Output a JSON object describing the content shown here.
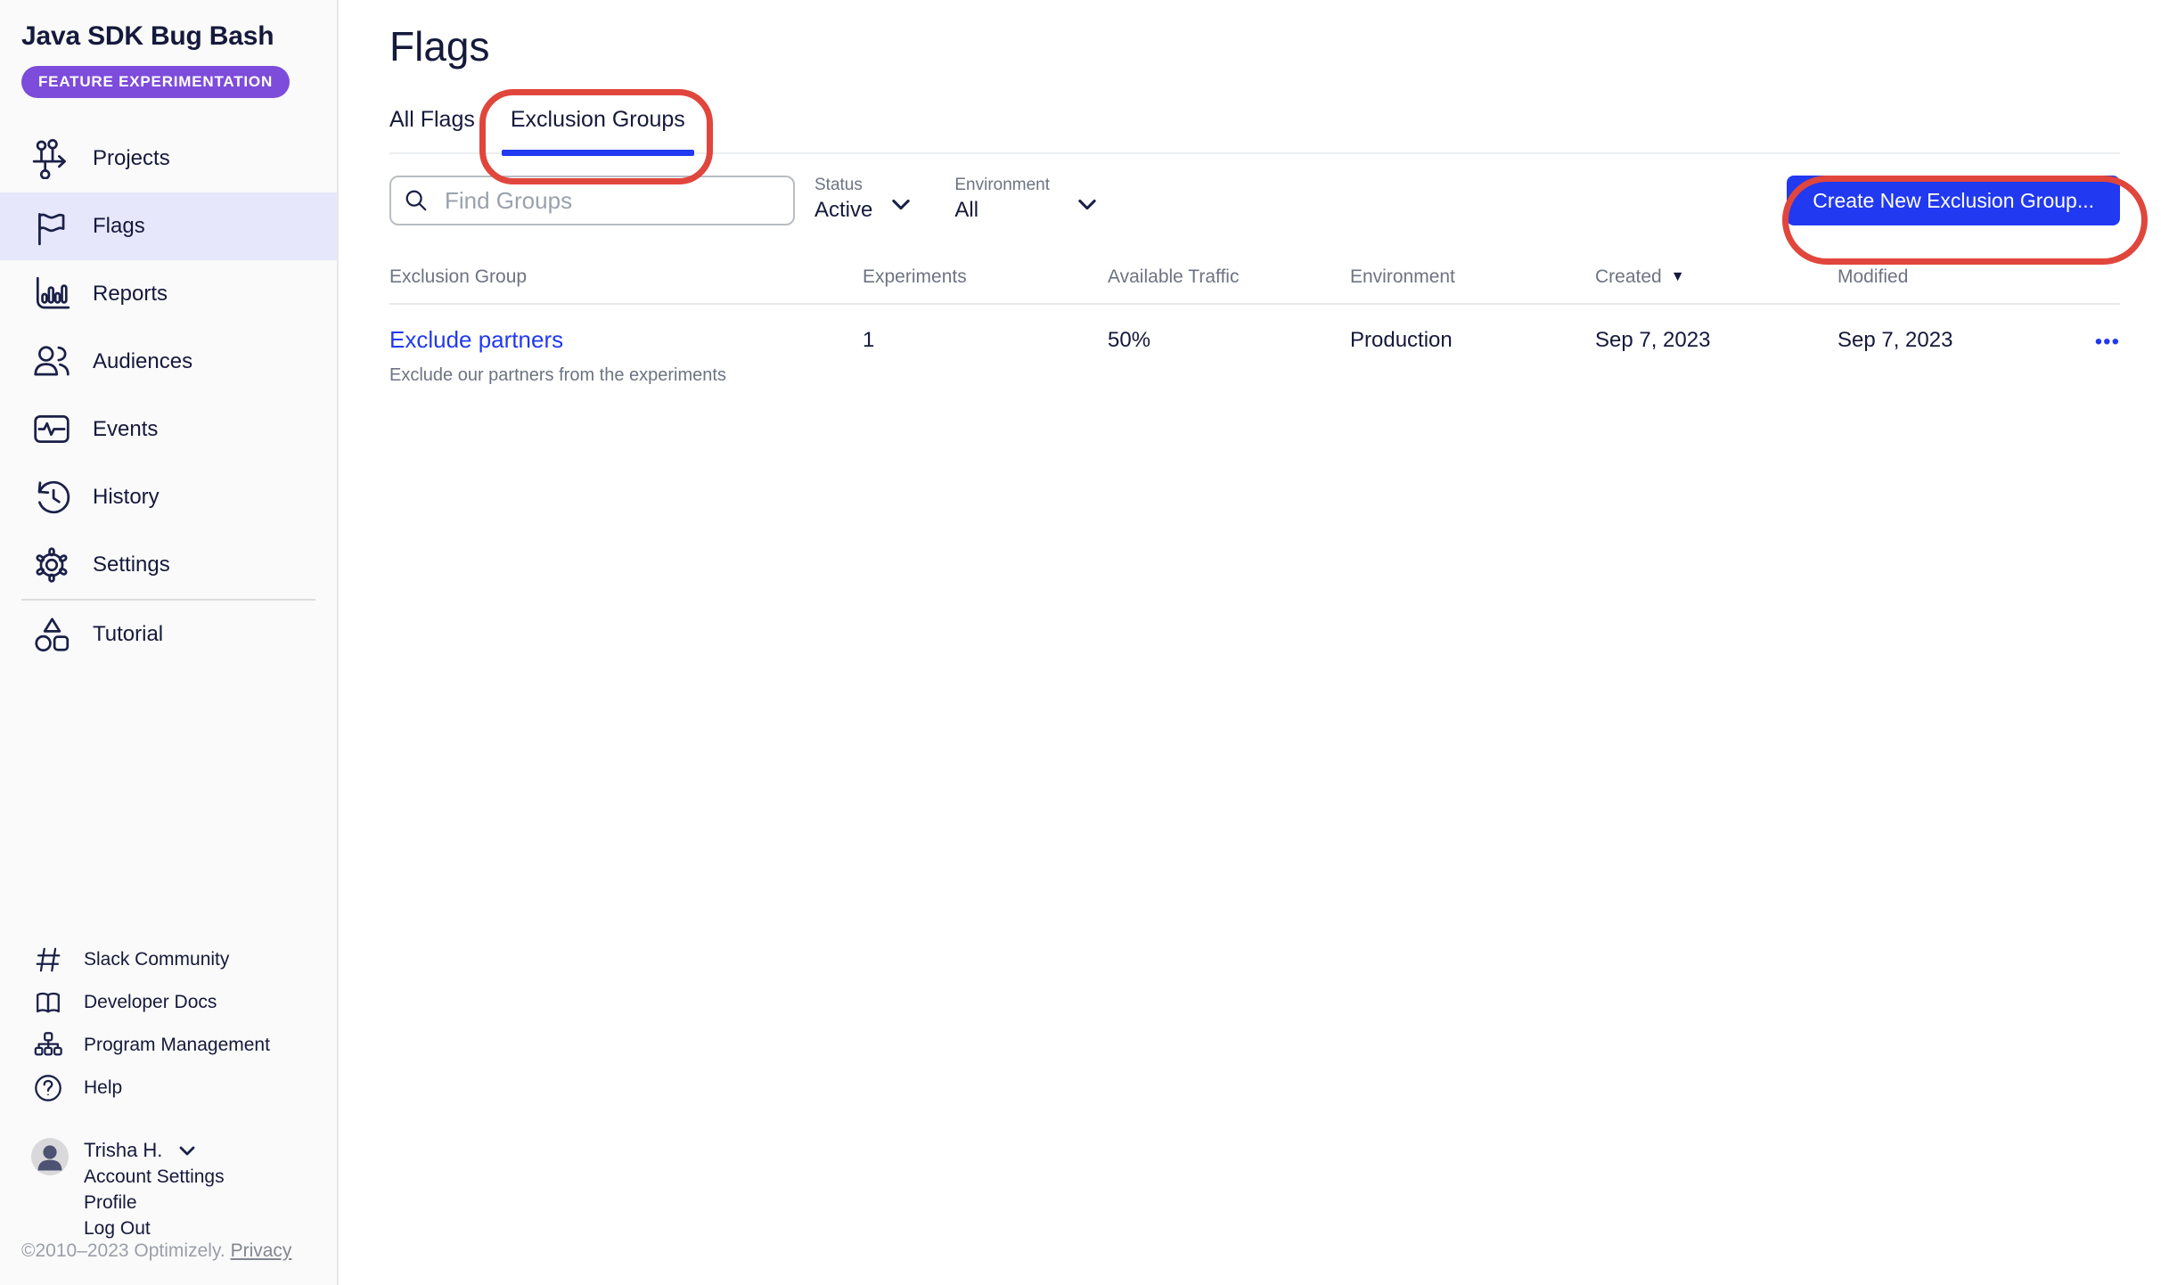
{
  "app": {
    "project_name": "Java SDK Bug Bash",
    "product_badge": "FEATURE EXPERIMENTATION"
  },
  "sidebar": {
    "nav": [
      {
        "label": "Projects",
        "icon": "projects-icon",
        "active": false
      },
      {
        "label": "Flags",
        "icon": "flag-icon",
        "active": true
      },
      {
        "label": "Reports",
        "icon": "bar-chart-icon",
        "active": false
      },
      {
        "label": "Audiences",
        "icon": "people-icon",
        "active": false
      },
      {
        "label": "Events",
        "icon": "monitor-pulse-icon",
        "active": false
      },
      {
        "label": "History",
        "icon": "history-clock-icon",
        "active": false
      },
      {
        "label": "Settings",
        "icon": "gear-icon",
        "active": false
      },
      {
        "label": "Tutorial",
        "icon": "shapes-icon",
        "active": false
      }
    ],
    "links": [
      {
        "label": "Slack Community",
        "icon": "hash-icon"
      },
      {
        "label": "Developer Docs",
        "icon": "book-icon"
      },
      {
        "label": "Program Management",
        "icon": "org-chart-icon"
      },
      {
        "label": "Help",
        "icon": "question-icon"
      }
    ],
    "user": {
      "name": "Trisha H.",
      "menu": [
        "Account Settings",
        "Profile",
        "Log Out"
      ]
    },
    "footer": {
      "copyright": "©2010–2023 Optimizely.",
      "privacy_label": "Privacy"
    }
  },
  "main": {
    "title": "Flags",
    "tabs": [
      {
        "label": "All Flags",
        "active": false
      },
      {
        "label": "Exclusion Groups",
        "active": true
      }
    ],
    "search": {
      "placeholder": "Find Groups"
    },
    "filters": {
      "status": {
        "label": "Status",
        "value": "Active"
      },
      "environment": {
        "label": "Environment",
        "value": "All"
      }
    },
    "create_button_label": "Create New Exclusion Group...",
    "table": {
      "columns": [
        "Exclusion Group",
        "Experiments",
        "Available Traffic",
        "Environment",
        "Created",
        "Modified"
      ],
      "sort": {
        "column": "Created",
        "direction": "desc"
      },
      "rows": [
        {
          "name": "Exclude partners",
          "description": "Exclude our partners from the experiments",
          "experiments": "1",
          "available_traffic": "50%",
          "environment": "Production",
          "created": "Sep 7, 2023",
          "modified": "Sep 7, 2023"
        }
      ]
    }
  },
  "icons": {
    "sort_desc": "▼",
    "row_menu_ellipsis": "•••"
  },
  "colors": {
    "accent_blue": "#2139f0",
    "badge_purple": "#7d4cdb",
    "annotation_red": "#e0463c",
    "nav_active_bg": "#e6e7fa",
    "text_navy": "#15193b",
    "sidebar_bg": "#fafafa"
  }
}
